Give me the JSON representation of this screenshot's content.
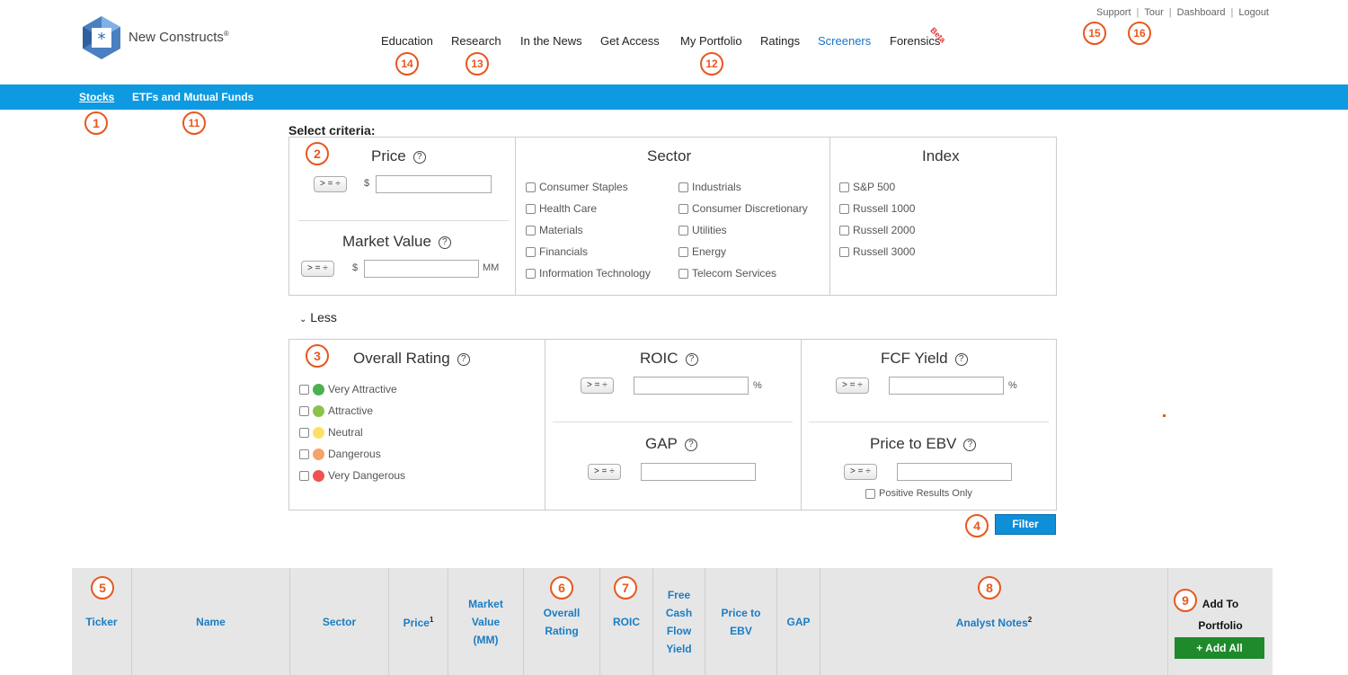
{
  "brand": {
    "name": "New Constructs",
    "reg": "®"
  },
  "topnav": [
    "Education",
    "Research",
    "In the News",
    "Get Access",
    "My Portfolio",
    "Ratings",
    "Screeners",
    "Forensics"
  ],
  "beta": "Beta",
  "toplinks": [
    "Support",
    "Tour",
    "Dashboard",
    "Logout"
  ],
  "tabs": [
    "Stocks",
    "ETFs and Mutual Funds"
  ],
  "criteria": {
    "title": "Select criteria:",
    "price": {
      "title": "Price",
      "op": "> =",
      "currency": "$"
    },
    "market_value": {
      "title": "Market Value",
      "op": "> =",
      "currency": "$",
      "unit": "MM"
    },
    "sector": {
      "title": "Sector",
      "items": [
        "Consumer Staples",
        "Health Care",
        "Materials",
        "Financials",
        "Information Technology",
        "Industrials",
        "Consumer Discretionary",
        "Utilities",
        "Energy",
        "Telecom Services"
      ]
    },
    "index": {
      "title": "Index",
      "items": [
        "S&P 500",
        "Russell 1000",
        "Russell 2000",
        "Russell 3000"
      ]
    },
    "less": "Less",
    "overall": {
      "title": "Overall Rating",
      "items": [
        "Very Attractive",
        "Attractive",
        "Neutral",
        "Dangerous",
        "Very Dangerous"
      ],
      "colors": [
        "#4caf50",
        "#8bc34a",
        "#ffe066",
        "#f4a36b",
        "#ef5350"
      ]
    },
    "roic": {
      "title": "ROIC",
      "op": "> =",
      "unit": "%"
    },
    "fcf": {
      "title": "FCF Yield",
      "op": "> =",
      "unit": "%"
    },
    "gap": {
      "title": "GAP",
      "op": "> ="
    },
    "ebv": {
      "title": "Price to EBV",
      "op": "> =",
      "positive": "Positive Results Only"
    },
    "filter": "Filter"
  },
  "table": {
    "ticker": "Ticker",
    "name": "Name",
    "sector": "Sector",
    "price": "Price",
    "price_sup": "1",
    "market_value": "Market Value (MM)",
    "overall_rating": "Overall Rating",
    "roic": "ROIC",
    "fcf": "Free Cash Flow Yield",
    "ebv": "Price to EBV",
    "gap": "GAP",
    "notes": "Analyst Notes",
    "notes_sup": "2",
    "add_to": "Add To Portfolio",
    "add_all": "+ Add All"
  },
  "markers": [
    "1",
    "2",
    "3",
    "4",
    "5",
    "6",
    "7",
    "8",
    "9",
    "11",
    "12",
    "13",
    "14",
    "15",
    "16"
  ]
}
